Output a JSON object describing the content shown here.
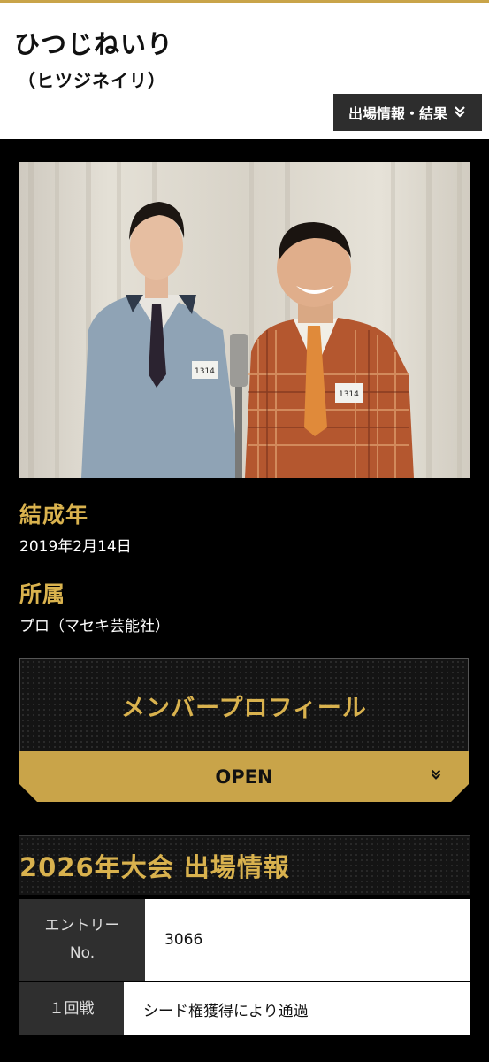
{
  "header": {
    "name": "ひつじねいり",
    "kana": "（ヒツジネイリ）",
    "info_button": "出場情報・結果",
    "chevron_icon": "double-chevron-down-icon"
  },
  "photo": {
    "badge_left": "1314",
    "badge_right": "1314"
  },
  "profile": {
    "formed_label": "結成年",
    "formed_value": "2019年2月14日",
    "affiliation_label": "所属",
    "affiliation_value": "プロ（マセキ芸能社）"
  },
  "member_profile": {
    "title": "メンバープロフィール",
    "open_label": "OPEN"
  },
  "entry_section": {
    "title": "2026年大会 出場情報",
    "rows": [
      {
        "header": "エントリーNo.",
        "value": "3066"
      },
      {
        "header": "１回戦",
        "value": "シード権獲得により通過"
      }
    ]
  },
  "colors": {
    "accent_gold": "#c9a449",
    "label_gold": "#d9b24e",
    "background": "#000000"
  }
}
